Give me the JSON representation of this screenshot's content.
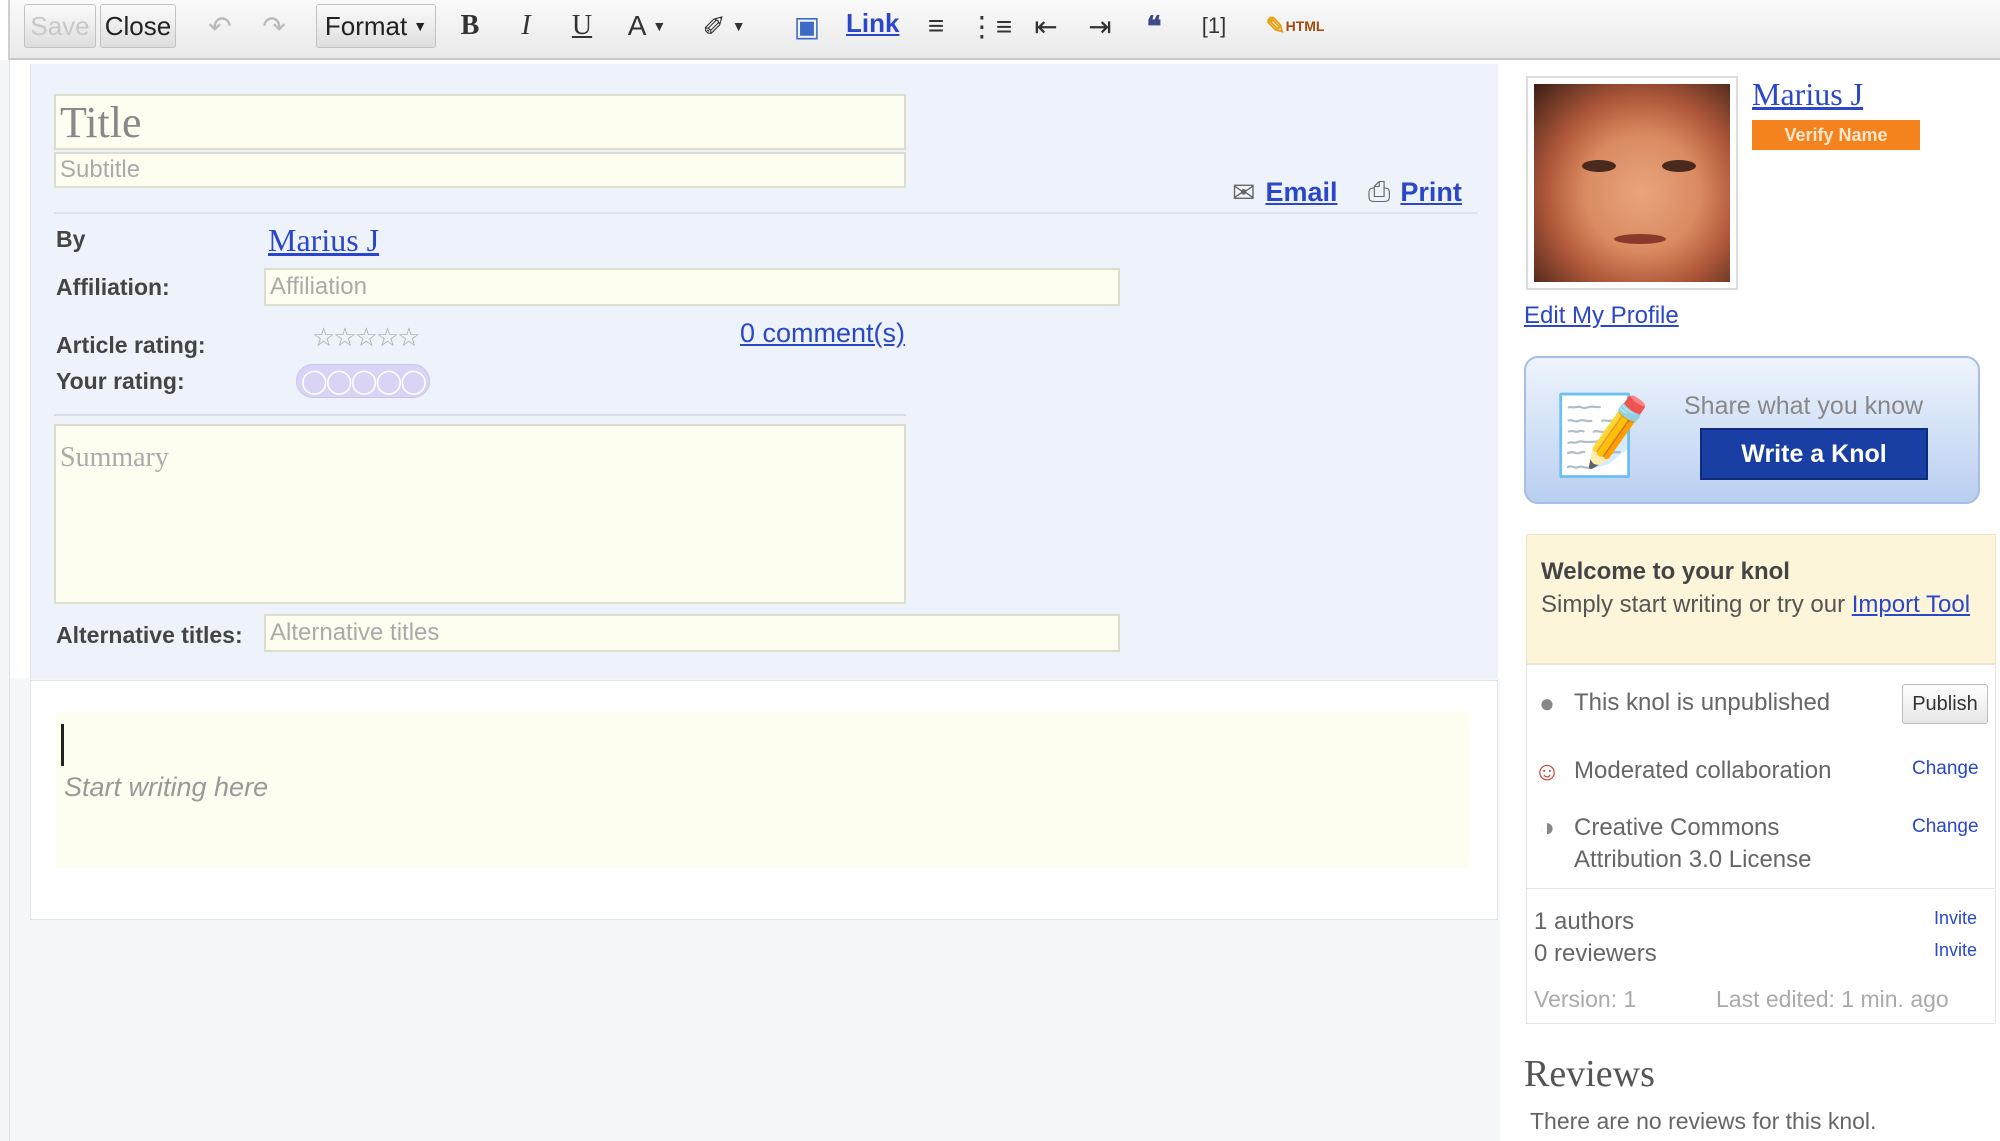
{
  "toolbar": {
    "save_label": "Save",
    "close_label": "Close",
    "format_label": "Format",
    "bold": "B",
    "italic": "I",
    "underline": "U",
    "text_color": "A",
    "link_label": "Link",
    "footnote": "[1]",
    "html_label": "HTML",
    "icons": [
      "undo-icon",
      "redo-icon",
      "text-color-icon",
      "highlight-icon",
      "image-icon",
      "numbered-list-icon",
      "bulleted-list-icon",
      "indent-less-icon",
      "indent-more-icon",
      "quote-icon",
      "html-pencil-icon"
    ]
  },
  "header": {
    "title_placeholder": "Title",
    "subtitle_placeholder": "Subtitle",
    "email_label": "Email",
    "print_label": "Print"
  },
  "meta": {
    "by_label": "By",
    "author_name": "Marius J",
    "affiliation_label": "Affiliation:",
    "affiliation_placeholder": "Affiliation",
    "article_rating_label": "Article rating:",
    "comments_link": "0 comment(s)",
    "your_rating_label": "Your rating:",
    "summary_placeholder": "Summary",
    "alt_titles_label": "Alternative titles:",
    "alt_titles_placeholder": "Alternative titles"
  },
  "editor": {
    "placeholder": "Start writing here"
  },
  "sidebar": {
    "profile_name": "Marius J",
    "verify_label": "Verify Name",
    "edit_profile": "Edit My Profile",
    "share_text": "Share what you know",
    "write_button": "Write a Knol",
    "welcome_title": "Welcome to your knol",
    "welcome_text": "Simply start writing or try our",
    "import_link": "Import Tool",
    "unpublished_text": "This knol is unpublished",
    "publish_button": "Publish",
    "collab_text": "Moderated collaboration",
    "change_label": "Change",
    "license_line1": "Creative Commons",
    "license_line2": "Attribution 3.0 License",
    "authors_count": "1 authors",
    "reviewers_count": "0 reviewers",
    "invite_label": "Invite",
    "version_text": "Version: 1",
    "last_edited_text": "Last edited: 1 min. ago",
    "reviews_heading": "Reviews",
    "reviews_text": "There are no reviews for this knol."
  },
  "colors": {
    "accent_link": "#2a47c9",
    "verify_badge": "#f4831e",
    "write_button": "#1a3fa4",
    "field_bg": "#fefef0",
    "panel_bg": "#eef2fb"
  }
}
